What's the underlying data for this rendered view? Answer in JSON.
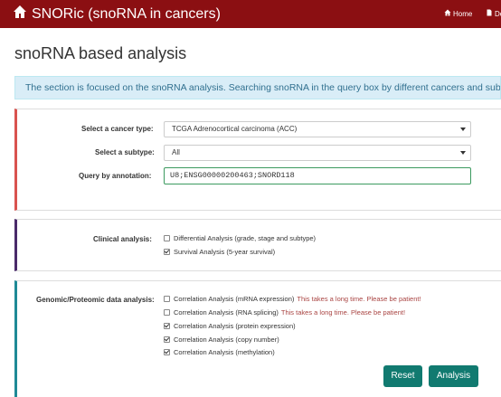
{
  "navbar": {
    "brand": "SNORic (snoRNA in cancers)",
    "home": "Home",
    "doc": "Do"
  },
  "page": {
    "title": "snoRNA based analysis",
    "info": "The section is focused on the snoRNA analysis. Searching snoRNA in the query box by different cancers and subtypes."
  },
  "query": {
    "cancer_label": "Select a cancer type:",
    "cancer_value": "TCGA Adrenocortical carcinoma (ACC)",
    "subtype_label": "Select a subtype:",
    "subtype_value": "All",
    "annotation_label": "Query by annotation:",
    "annotation_value": "U8;ENSG00000200463;SNORD118"
  },
  "clinical": {
    "label": "Clinical analysis:",
    "options": [
      {
        "text": "Differential Analysis (grade, stage and subtype)",
        "checked": false
      },
      {
        "text": "Survival Analysis (5-year survival)",
        "checked": true
      }
    ]
  },
  "genomic": {
    "label": "Genomic/Proteomic data analysis:",
    "options": [
      {
        "text": "Correlation Analysis (mRNA expression)",
        "warning": "This takes a long time. Please be patient!",
        "checked": false
      },
      {
        "text": "Correlation Analysis (RNA splicing)",
        "warning": "This takes a long time. Please be patient!",
        "checked": false
      },
      {
        "text": "Correlation Analysis (protein expression)",
        "warning": "",
        "checked": true
      },
      {
        "text": "Correlation Analysis (copy number)",
        "warning": "",
        "checked": true
      },
      {
        "text": "Correlation Analysis (methylation)",
        "warning": "",
        "checked": true
      }
    ]
  },
  "buttons": {
    "reset": "Reset",
    "analysis": "Analysis"
  }
}
